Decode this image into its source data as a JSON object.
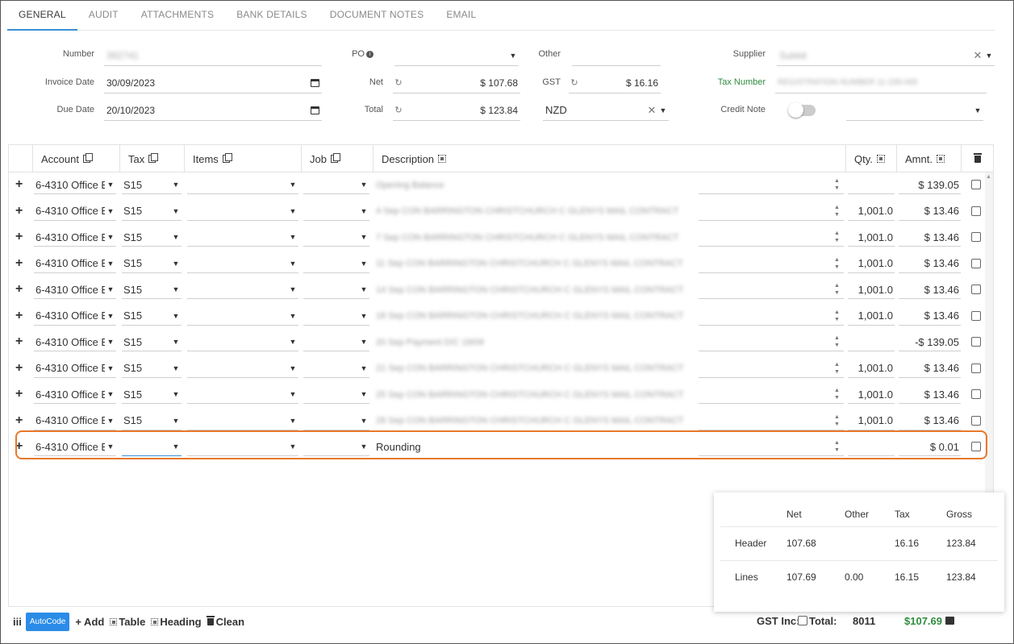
{
  "tabs": [
    "GENERAL",
    "AUDIT",
    "ATTACHMENTS",
    "BANK DETAILS",
    "DOCUMENT NOTES",
    "EMAIL"
  ],
  "header": {
    "number_label": "Number",
    "number_value": "392741",
    "invoice_date_label": "Invoice Date",
    "invoice_date_value": "30/09/2023",
    "due_date_label": "Due Date",
    "due_date_value": "20/10/2023",
    "po_label": "PO",
    "net_label": "Net",
    "net_value": "$ 107.68",
    "total_label": "Total",
    "total_value": "$ 123.84",
    "other_label": "Other",
    "gst_label": "GST",
    "gst_value": "$ 16.16",
    "currency_value": "NZD",
    "supplier_label": "Supplier",
    "supplier_value": "Subbit",
    "tax_number_label": "Tax Number",
    "tax_number_value": "REGISTRATION NUMBER 11-239-065",
    "credit_note_label": "Credit Note"
  },
  "grid": {
    "columns": {
      "account": "Account",
      "tax": "Tax",
      "items": "Items",
      "job": "Job",
      "description": "Description",
      "qty": "Qty.",
      "amount": "Amnt."
    },
    "rows": [
      {
        "plus": "+",
        "account": "6-4310 Office E",
        "tax": "S15",
        "description": "Opening Balance",
        "qty": "",
        "amount": "$ 139.05"
      },
      {
        "plus": "+",
        "account": "6-4310 Office E",
        "tax": "S15",
        "description": "4 Sep CON BARRINGTON CHRISTCHURCH C GLENYS MAIL CONTRACT",
        "qty": "1,001.0",
        "amount": "$ 13.46"
      },
      {
        "plus": "+",
        "account": "6-4310 Office E",
        "tax": "S15",
        "description": "7 Sep CON BARRINGTON CHRISTCHURCH C GLENYS MAIL CONTRACT",
        "qty": "1,001.0",
        "amount": "$ 13.46"
      },
      {
        "plus": "+",
        "account": "6-4310 Office E",
        "tax": "S15",
        "description": "11 Sep CON BARRINGTON CHRISTCHURCH C GLENYS MAIL CONTRACT",
        "qty": "1,001.0",
        "amount": "$ 13.46"
      },
      {
        "plus": "+",
        "account": "6-4310 Office E",
        "tax": "S15",
        "description": "14 Sep CON BARRINGTON CHRISTCHURCH C GLENYS MAIL CONTRACT",
        "qty": "1,001.0",
        "amount": "$ 13.46"
      },
      {
        "plus": "+",
        "account": "6-4310 Office E",
        "tax": "S15",
        "description": "18 Sep CON BARRINGTON CHRISTCHURCH C GLENYS MAIL CONTRACT",
        "qty": "1,001.0",
        "amount": "$ 13.46"
      },
      {
        "plus": "+",
        "account": "6-4310 Office E",
        "tax": "S15",
        "description": "20 Sep Payment D/C 19/09",
        "qty": "",
        "amount": "-$ 139.05"
      },
      {
        "plus": "+",
        "account": "6-4310 Office E",
        "tax": "S15",
        "description": "21 Sep CON BARRINGTON CHRISTCHURCH C GLENYS MAIL CONTRACT",
        "qty": "1,001.0",
        "amount": "$ 13.46"
      },
      {
        "plus": "+",
        "account": "6-4310 Office E",
        "tax": "S15",
        "description": "25 Sep CON BARRINGTON CHRISTCHURCH C GLENYS MAIL CONTRACT",
        "qty": "1,001.0",
        "amount": "$ 13.46"
      },
      {
        "plus": "+",
        "account": "6-4310 Office E",
        "tax": "S15",
        "description": "28 Sep CON BARRINGTON CHRISTCHURCH C GLENYS MAIL CONTRACT",
        "qty": "1,001.0",
        "amount": "$ 13.46"
      },
      {
        "plus": "+",
        "account": "6-4310 Office E",
        "tax": "",
        "description": "Rounding",
        "qty": "",
        "amount": "$ 0.01"
      }
    ]
  },
  "totals": {
    "headers": [
      "",
      "Net",
      "Other",
      "Tax",
      "Gross"
    ],
    "header_row": {
      "label": "Header",
      "net": "107.68",
      "other": "",
      "tax": "16.16",
      "gross": "123.84"
    },
    "lines_row": {
      "label": "Lines",
      "net": "107.69",
      "other": "0.00",
      "tax": "16.15",
      "gross": "123.84"
    }
  },
  "footer": {
    "columns_icon": "iii",
    "autocode": "AutoCode",
    "add": "+ Add",
    "table": "Table",
    "heading": "Heading",
    "clean": "Clean",
    "gst_inc_label": "GST Inc:",
    "total_label": "Total:",
    "total_count": "8011",
    "total_amount": "$107.69"
  },
  "colors": {
    "accent": "#3a8fd6",
    "highlight": "#e8782a",
    "autocode": "#2b8ce8",
    "total_green": "#2e8b3e"
  }
}
